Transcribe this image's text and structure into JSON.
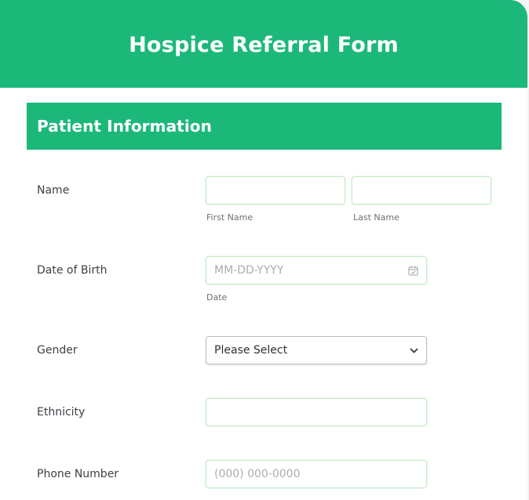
{
  "form": {
    "title": "Hospice Referral Form"
  },
  "section": {
    "title": "Patient Information"
  },
  "name": {
    "label": "Name",
    "first_value": "",
    "last_value": "",
    "first_sublabel": "First Name",
    "last_sublabel": "Last Name"
  },
  "dob": {
    "label": "Date of Birth",
    "placeholder": "MM-DD-YYYY",
    "value": "",
    "sublabel": "Date",
    "icon": "calendar-icon"
  },
  "gender": {
    "label": "Gender",
    "selected": "Please Select",
    "icon": "chevron-down-icon"
  },
  "ethnicity": {
    "label": "Ethnicity",
    "value": ""
  },
  "phone": {
    "label": "Phone Number",
    "placeholder": "(000) 000-0000",
    "value": ""
  },
  "colors": {
    "brand": "#1cb87a",
    "field_border": "#c5ecc9"
  }
}
